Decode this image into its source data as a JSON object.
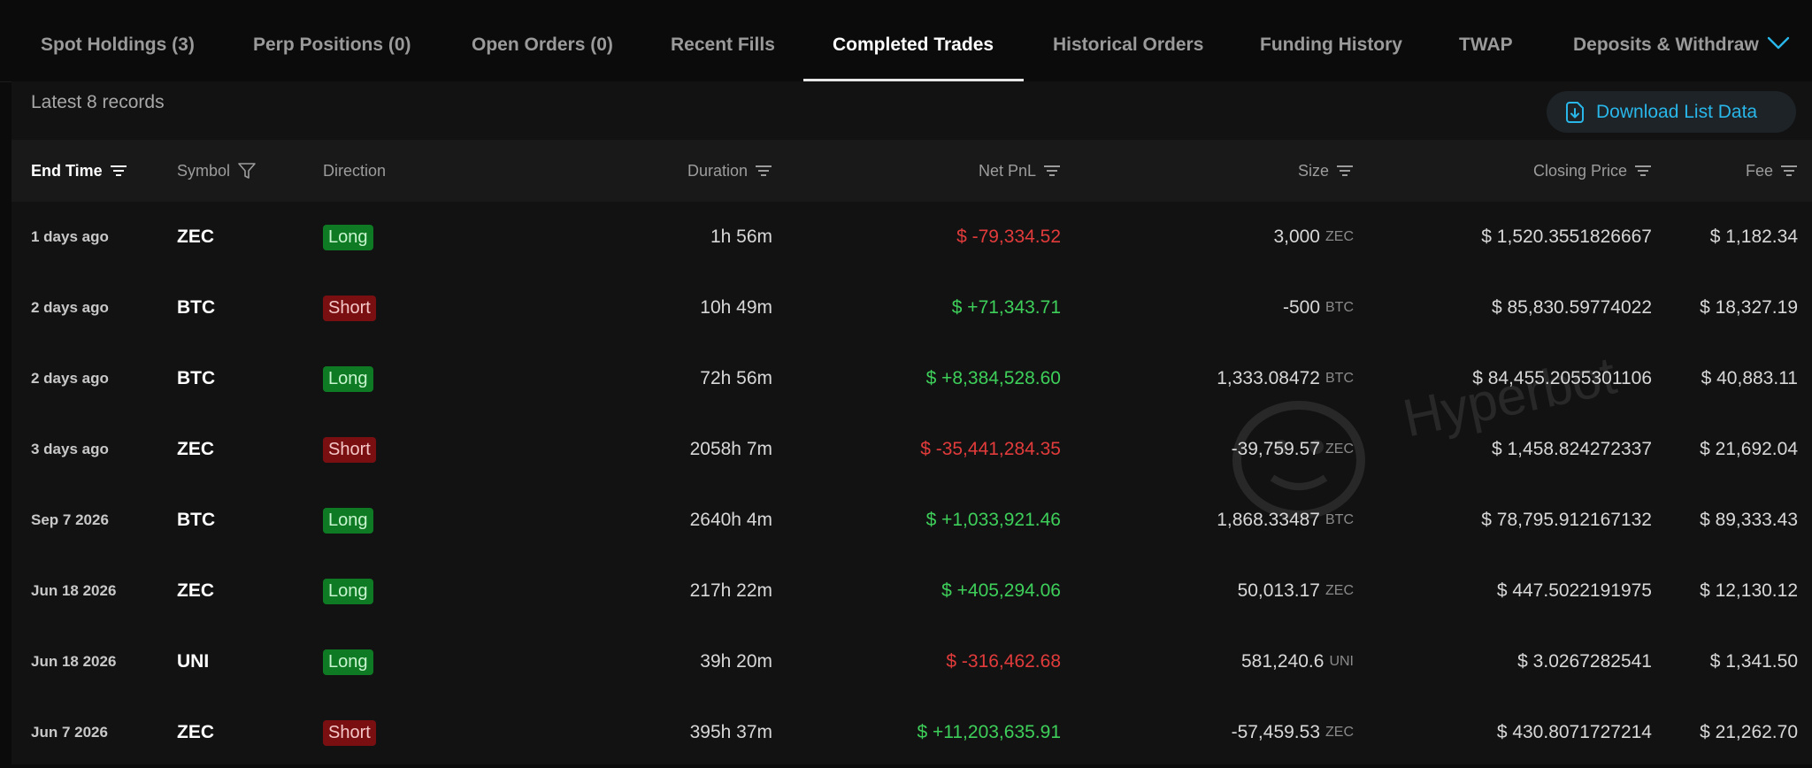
{
  "tabs": [
    {
      "label": "Spot Holdings (3)"
    },
    {
      "label": "Perp Positions (0)"
    },
    {
      "label": "Open Orders (0)"
    },
    {
      "label": "Recent Fills"
    },
    {
      "label": "Completed Trades"
    },
    {
      "label": "Historical Orders"
    },
    {
      "label": "Funding History"
    },
    {
      "label": "TWAP"
    },
    {
      "label": "Deposits & Withdraw"
    }
  ],
  "active_tab": "Completed Trades",
  "panel": {
    "records_label": "Latest 8 records",
    "download_label": "Download List Data"
  },
  "columns": {
    "end_time": "End Time",
    "symbol": "Symbol",
    "direction": "Direction",
    "duration": "Duration",
    "net_pnl": "Net PnL",
    "size": "Size",
    "closing_price": "Closing Price",
    "fee": "Fee"
  },
  "rows": [
    {
      "end_time": "1 days ago",
      "symbol": "ZEC",
      "direction": "Long",
      "duration": "1h 56m",
      "net_pnl": "$ -79,334.52",
      "size": "3,000",
      "size_unit": "ZEC",
      "closing_price": "$ 1,520.3551826667",
      "fee": "$ 1,182.34"
    },
    {
      "end_time": "2 days ago",
      "symbol": "BTC",
      "direction": "Short",
      "duration": "10h 49m",
      "net_pnl": "$ +71,343.71",
      "size": "-500",
      "size_unit": "BTC",
      "closing_price": "$ 85,830.59774022",
      "fee": "$ 18,327.19"
    },
    {
      "end_time": "2 days ago",
      "symbol": "BTC",
      "direction": "Long",
      "duration": "72h 56m",
      "net_pnl": "$ +8,384,528.60",
      "size": "1,333.08472",
      "size_unit": "BTC",
      "closing_price": "$ 84,455.2055301106",
      "fee": "$ 40,883.11"
    },
    {
      "end_time": "3 days ago",
      "symbol": "ZEC",
      "direction": "Short",
      "duration": "2058h 7m",
      "net_pnl": "$ -35,441,284.35",
      "size": "-39,759.57",
      "size_unit": "ZEC",
      "closing_price": "$ 1,458.824272337",
      "fee": "$ 21,692.04"
    },
    {
      "end_time": "Sep 7 2026",
      "symbol": "BTC",
      "direction": "Long",
      "duration": "2640h 4m",
      "net_pnl": "$ +1,033,921.46",
      "size": "1,868.33487",
      "size_unit": "BTC",
      "closing_price": "$ 78,795.912167132",
      "fee": "$ 89,333.43"
    },
    {
      "end_time": "Jun 18 2026",
      "symbol": "ZEC",
      "direction": "Long",
      "duration": "217h 22m",
      "net_pnl": "$ +405,294.06",
      "size": "50,013.17",
      "size_unit": "ZEC",
      "closing_price": "$ 447.5022191975",
      "fee": "$ 12,130.12"
    },
    {
      "end_time": "Jun 18 2026",
      "symbol": "UNI",
      "direction": "Long",
      "duration": "39h 20m",
      "net_pnl": "$ -316,462.68",
      "size": "581,240.6",
      "size_unit": "UNI",
      "closing_price": "$ 3.0267282541",
      "fee": "$ 1,341.50"
    },
    {
      "end_time": "Jun 7 2026",
      "symbol": "ZEC",
      "direction": "Short",
      "duration": "395h 37m",
      "net_pnl": "$ +11,203,635.91",
      "size": "-57,459.53",
      "size_unit": "ZEC",
      "closing_price": "$ 430.8071727214",
      "fee": "$ 21,262.70"
    }
  ],
  "watermark": "Hyperbot",
  "colors": {
    "positive": "#3ecf5a",
    "negative": "#e23b3b",
    "accent": "#29b6e8",
    "long_badge": "#0f7a24",
    "short_badge": "#7a0f12"
  }
}
